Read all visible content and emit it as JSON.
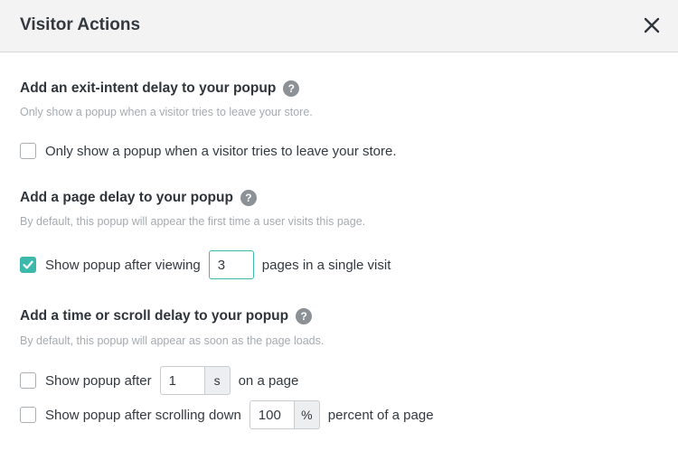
{
  "header": {
    "title": "Visitor Actions"
  },
  "exit_intent": {
    "title": "Add an exit-intent delay to your popup",
    "help": "?",
    "description": "Only show a popup when a visitor tries to leave your store.",
    "checkbox_label": "Only show a popup when a visitor tries to leave your store.",
    "checked": false
  },
  "page_delay": {
    "title": "Add a page delay to your popup",
    "help": "?",
    "description": "By default, this popup will appear the first time a user visits this page.",
    "label_before": "Show popup after viewing",
    "pages_value": "3",
    "label_after": "pages in a single visit",
    "checked": true
  },
  "time_scroll": {
    "title": "Add a time or scroll delay to your popup",
    "help": "?",
    "description": "By default, this popup will appear as soon as the page loads.",
    "time_row": {
      "label_before": "Show popup after",
      "value": "1",
      "unit": "s",
      "label_after": "on a page",
      "checked": false
    },
    "scroll_row": {
      "label_before": "Show popup after scrolling down",
      "value": "100",
      "unit": "%",
      "label_after": "percent of a page",
      "checked": false
    }
  },
  "colors": {
    "accent": "#3cb9ab",
    "header_bg": "#f3f3f4",
    "muted_text": "#a6abb0"
  },
  "icons": {
    "close": "close-icon",
    "help": "question-circle-icon",
    "check": "checkmark-icon"
  }
}
